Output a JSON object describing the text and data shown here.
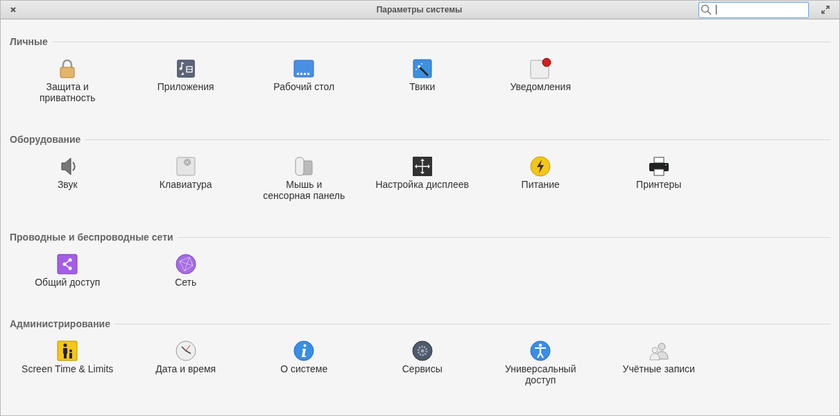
{
  "window": {
    "title": "Параметры системы"
  },
  "sections": [
    {
      "title": "Личные",
      "items": [
        {
          "kind": "lock",
          "label": "Защита и\nприватность"
        },
        {
          "kind": "apps",
          "label": "Приложения"
        },
        {
          "kind": "desktop",
          "label": "Рабочий стол"
        },
        {
          "kind": "tweaks",
          "label": "Твики"
        },
        {
          "kind": "notifications",
          "label": "Уведомления"
        }
      ]
    },
    {
      "title": "Оборудование",
      "items": [
        {
          "kind": "sound",
          "label": "Звук"
        },
        {
          "kind": "keyboard",
          "label": "Клавиатура"
        },
        {
          "kind": "mouse",
          "label": "Мышь и\nсенсорная панель"
        },
        {
          "kind": "display",
          "label": "Настройка дисплеев"
        },
        {
          "kind": "power",
          "label": "Питание"
        },
        {
          "kind": "printer",
          "label": "Принтеры"
        }
      ]
    },
    {
      "title": "Проводные и беспроводные сети",
      "items": [
        {
          "kind": "sharing",
          "label": "Общий доступ"
        },
        {
          "kind": "network",
          "label": "Сеть"
        }
      ]
    },
    {
      "title": "Администрирование",
      "items": [
        {
          "kind": "parental",
          "label": "Screen Time & Limits"
        },
        {
          "kind": "clock",
          "label": "Дата и время"
        },
        {
          "kind": "info",
          "label": "О системе"
        },
        {
          "kind": "services",
          "label": "Сервисы"
        },
        {
          "kind": "accessibility",
          "label": "Универсальный\nдоступ"
        },
        {
          "kind": "users",
          "label": "Учётные записи"
        }
      ]
    }
  ]
}
